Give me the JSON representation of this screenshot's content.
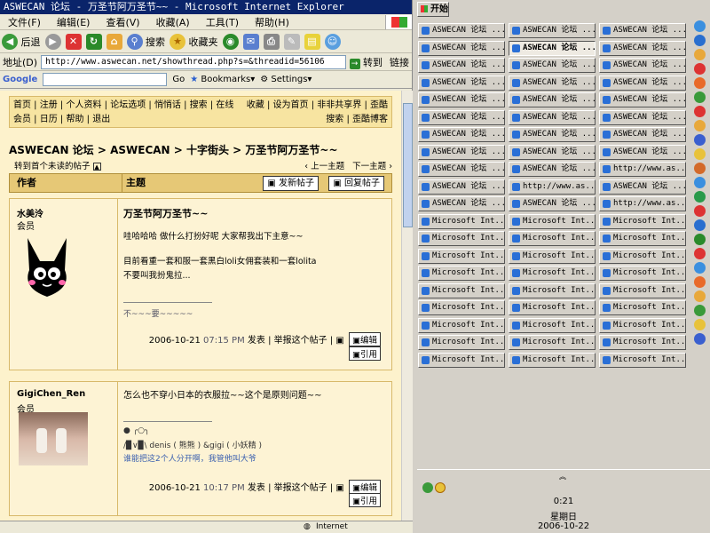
{
  "window": {
    "title": "ASWECAN 论坛 - 万圣节阿万圣节~~ - Microsoft Internet Explorer"
  },
  "menu": [
    "文件(F)",
    "编辑(E)",
    "查看(V)",
    "收藏(A)",
    "工具(T)",
    "帮助(H)"
  ],
  "toolbar": {
    "back": "后退",
    "search": "搜索",
    "favorites": "收藏夹"
  },
  "address": {
    "label": "地址(D)",
    "url": "http://www.aswecan.net/showthread.php?s=&threadid=56106",
    "go": "转到",
    "links": "链接"
  },
  "googlebar": {
    "go": "Go",
    "bookmarks": "Bookmarks▾",
    "settings": "Settings▾"
  },
  "forum_nav": {
    "row1": [
      "首页",
      "注册",
      "个人资料",
      "论坛选项",
      "悄悄话",
      "搜索",
      "在线"
    ],
    "row1_right": [
      "收藏",
      "设为首页",
      "非非共享界",
      "歪酷"
    ],
    "row2": [
      "会员",
      "日历",
      "帮助",
      "退出"
    ],
    "row2_right": [
      "搜索",
      "歪酷博客"
    ]
  },
  "breadcrumb": "ASWECAN 论坛 > ASWECAN > 十字街头 > 万圣节阿万圣节~~",
  "unread_link": "转到首个未读的帖子",
  "thread_nav": {
    "prev": "上一主题",
    "next": "下一主题"
  },
  "table_header": {
    "author": "作者",
    "subject": "主题",
    "new_post": "发新帖子",
    "reply": "回复帖子"
  },
  "posts": [
    {
      "author": "水美泠",
      "role": "会员",
      "title": "万圣节阿万圣节~~",
      "lines": [
        "哇哈哈哈 做什么打扮好呢 大家帮我出下主意~~",
        "目前看重一套和服一套黑白loli女佣套装和一套lolita",
        "不要叫我扮鬼拉..."
      ],
      "signature": "不~~~要~~~~~",
      "date": "2006-10-21",
      "time": "07:15 PM",
      "posted": "发表",
      "report": "举报这个帖子",
      "edit": "编辑",
      "quote": "引用"
    },
    {
      "author": "GigiChen_Ren",
      "role": "会员",
      "lines": [
        "怎么也不穿小日本的衣服拉~~这个是原则问题~~"
      ],
      "signature": [
        "/▉∨▉\\ denis ( 熊熊 ) &gigi ( 小妖精 )",
        "谁能把这2个人分开啊，我管他叫大爷"
      ],
      "date": "2006-10-21",
      "time": "10:17 PM",
      "posted": "发表",
      "report": "举报这个帖子",
      "edit": "编辑",
      "quote": "引用"
    }
  ],
  "statusbar": {
    "zone": "Internet"
  },
  "taskbar": {
    "start": "开始",
    "aswecan_label": "ASWECAN 论坛 ...",
    "url_label": "http://www.as...",
    "ie_label": "Microsoft Int...",
    "clock": {
      "time": "0:21",
      "day": "星期日",
      "date": "2006-10-22"
    }
  }
}
